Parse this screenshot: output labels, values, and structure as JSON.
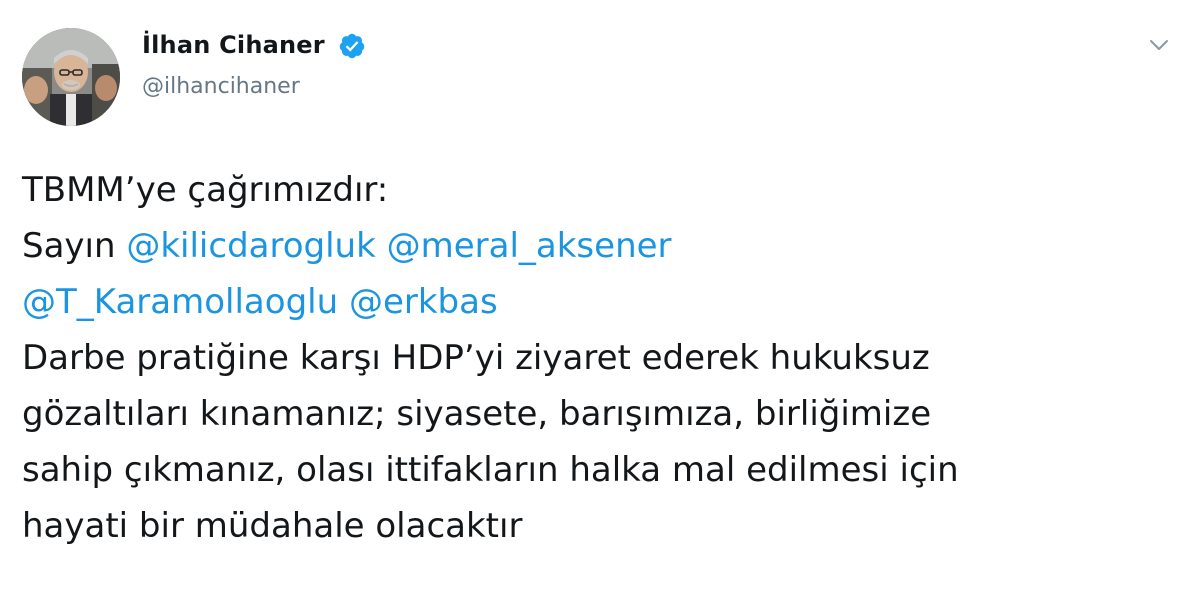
{
  "author": {
    "display_name": "İlhan Cihaner",
    "handle": "@ilhancihaner",
    "verified_icon": "verified-badge-icon",
    "avatar_icon": "profile-photo"
  },
  "menu": {
    "icon": "chevron-down-icon"
  },
  "tweet": {
    "line1": "TBMM’ye çağrımızdır:",
    "line2_prefix": "Sayın ",
    "mention1": "@kilicdarogluk",
    "mention2": "@meral_aksener",
    "mention3": "@T_Karamollaoglu",
    "mention4": "@erkbas",
    "line4": "Darbe pratiğine karşı HDP’yi ziyaret ederek hukuksuz",
    "line5": "gözaltıları kınamanız; siyasete, barışımıza, birliğimize",
    "line6": "sahip çıkmanız, olası ittifakların halka mal edilmesi için",
    "line7": "hayati bir müdahale olacaktır"
  },
  "colors": {
    "text": "#14171a",
    "secondary": "#657786",
    "link": "#1b95e0",
    "verified": "#1da1f2"
  }
}
